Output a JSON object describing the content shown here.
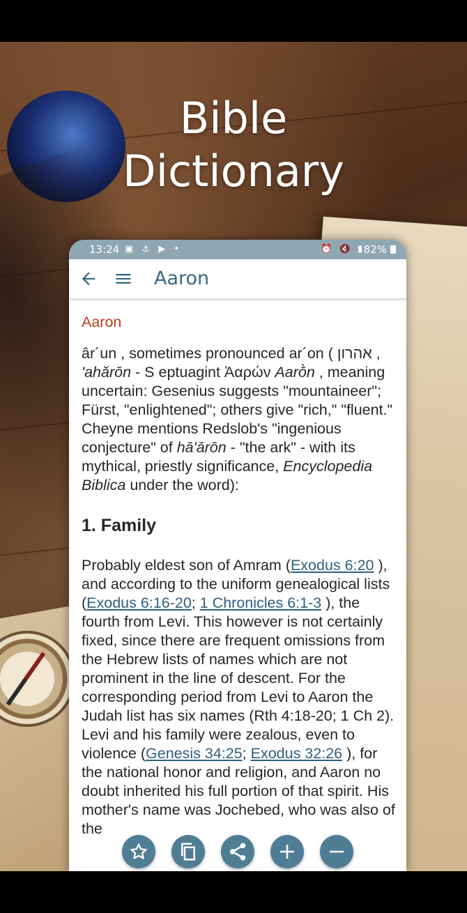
{
  "promo": {
    "title_line1": "Bible",
    "title_line2": "Dictionary"
  },
  "status_bar": {
    "time": "13:24",
    "battery": "82%"
  },
  "app_bar": {
    "title": "Aaron"
  },
  "entry": {
    "title": "Aaron",
    "intro": [
      {
        "t": "âr´un , sometimes pronounced ar´on ( אהרון , "
      },
      {
        "i": "'ahărōn"
      },
      {
        "t": " - S eptuagint Ἀαρών "
      },
      {
        "i": "Aarṑn"
      },
      {
        "t": " , meaning uncertain: Gesenius suggests \"mountaineer\"; Fürst, \"enlightened\"; others give \"rich,\" \"fluent.\" Cheyne mentions Redslob's \"ingenious conjecture\" of "
      },
      {
        "i": "hā'ārōn"
      },
      {
        "t": " - \"the ark\" - with its mythical, priestly significance, "
      },
      {
        "i": "Encyclopedia Biblica"
      },
      {
        "t": " under the word):"
      }
    ],
    "section1_heading": "1. Family",
    "section1": [
      {
        "t": "Probably eldest son of Amram ("
      },
      {
        "a": "Exodus 6:20"
      },
      {
        "t": " ), and according to the uniform genealogical lists ("
      },
      {
        "a": "Exodus 6:16-20"
      },
      {
        "t": "; "
      },
      {
        "a": "1 Chronicles 6:1-3"
      },
      {
        "t": " ), the fourth from Levi. This however is not certainly fixed, since there are frequent omissions from the Hebrew lists of names which are not prominent in the line of descent. For the corresponding period from Levi to Aaron the Judah list has six names (Rth 4:18-20; 1 Ch 2). Levi and his family were zealous, even to violence ("
      },
      {
        "a": "Genesis 34:25"
      },
      {
        "t": "; "
      },
      {
        "a": "Exodus 32:26"
      },
      {
        "t": " ), for the national honor and religion, and Aaron no doubt inherited his full portion of that spirit. His mother's name was Jochebed, who was also of the"
      }
    ]
  },
  "fabs": [
    {
      "name": "favorite-button",
      "icon": "star-icon"
    },
    {
      "name": "copy-button",
      "icon": "copy-icon"
    },
    {
      "name": "share-button",
      "icon": "share-icon"
    },
    {
      "name": "zoom-in-button",
      "icon": "plus-icon"
    },
    {
      "name": "zoom-out-button",
      "icon": "minus-icon"
    }
  ],
  "colors": {
    "accent": "#4f7d94",
    "title_red": "#c0381e",
    "link": "#2f5f7f",
    "statusbar": "#8fa7b3"
  }
}
